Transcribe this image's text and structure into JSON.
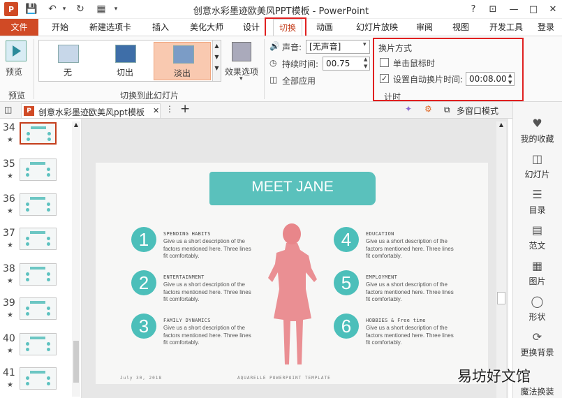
{
  "app": {
    "title": "创意水彩墨迹欧美风PPT模板 - PowerPoint"
  },
  "window_controls": {
    "help": "?",
    "restore_ribbon": "⊡",
    "minimize": "—",
    "maximize": "□",
    "close": "✕"
  },
  "ribbon_tabs": [
    "文件",
    "开始",
    "新建选项卡",
    "插入",
    "美化大师",
    "设计",
    "切换",
    "动画",
    "幻灯片放映",
    "审阅",
    "视图",
    "开发工具",
    "登录"
  ],
  "active_tab": "切换",
  "ribbon": {
    "preview_label": "预览",
    "preview_group": "预览",
    "gallery": [
      "无",
      "切出",
      "淡出"
    ],
    "gallery_selected": "淡出",
    "effect_options": "效果选项",
    "transition_group": "切换到此幻灯片",
    "sound_label": "声音:",
    "sound_value": "[无声音]",
    "duration_label": "持续时间:",
    "duration_value": "00.75",
    "apply_all": "全部应用",
    "advance_title": "换片方式",
    "on_click_label": "单击鼠标时",
    "on_click_checked": false,
    "auto_label": "设置自动换片时间:",
    "auto_checked": true,
    "auto_value": "00:08.00",
    "timing_group": "计时"
  },
  "doc_tab": {
    "name": "创意水彩墨迹欧美风ppt模板",
    "multiwindow": "多窗口模式",
    "more": "⋮",
    "add": "+"
  },
  "thumbnails": [
    {
      "num": "34",
      "selected": true
    },
    {
      "num": "35",
      "selected": false
    },
    {
      "num": "36",
      "selected": false
    },
    {
      "num": "37",
      "selected": false
    },
    {
      "num": "38",
      "selected": false
    },
    {
      "num": "39",
      "selected": false
    },
    {
      "num": "40",
      "selected": false
    },
    {
      "num": "41",
      "selected": false
    }
  ],
  "slide": {
    "title": "MEET JANE",
    "items": [
      {
        "n": "1",
        "head": "SPENDING HABITS",
        "body": "Give us a short description of the factors mentioned here. Three lines fit comfortably."
      },
      {
        "n": "2",
        "head": "ENTERTAINMENT",
        "body": "Give us a short description of the factors mentioned here. Three lines fit comfortably."
      },
      {
        "n": "3",
        "head": "FAMILY DYNAMICS",
        "body": "Give us a short description of the factors mentioned here. Three lines fit comfortably."
      },
      {
        "n": "4",
        "head": "EDUCATION",
        "body": "Give us a short description of the factors mentioned here. Three lines fit comfortably."
      },
      {
        "n": "5",
        "head": "EMPLOYMENT",
        "body": "Give us a short description of the factors mentioned here. Three lines fit comfortably."
      },
      {
        "n": "6",
        "head": "HOBBIES & Free time",
        "body": "Give us a short description of the factors mentioned here. Three lines fit comfortably."
      }
    ],
    "footer_left": "July 30, 2018",
    "footer_center": "AQUARELLE POWERPOINT TEMPLATE"
  },
  "right_panel": [
    "我的收藏",
    "幻灯片",
    "目录",
    "范文",
    "图片",
    "形状",
    "更换背景",
    "魔法换装"
  ],
  "watermark": "易坊好文馆",
  "colors": {
    "accent": "#d04a25",
    "teal": "#4cbfba",
    "figure": "#e8868a",
    "highlight": "#e02020"
  }
}
